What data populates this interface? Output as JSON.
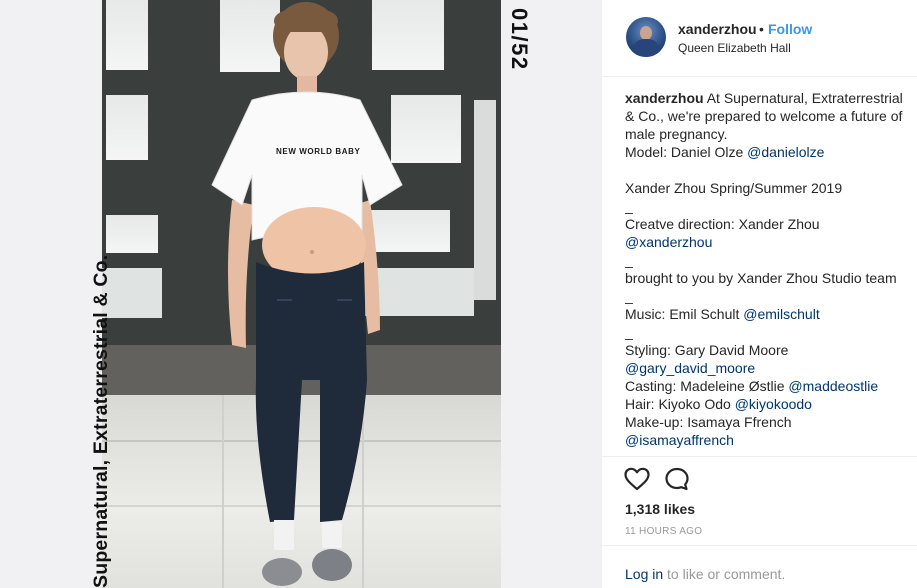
{
  "media": {
    "side_text_left": "Supernatural, Extraterrestrial & Co.",
    "side_text_right": "01/52",
    "shirt_text": "NEW WORLD BABY"
  },
  "header": {
    "username": "xanderzhou",
    "separator": "•",
    "follow_label": "Follow",
    "location": "Queen Elizabeth Hall"
  },
  "caption": {
    "username": "xanderzhou",
    "lines": [
      {
        "text": " At Supernatural, Extraterrestrial & Co., we're prepared to welcome a future of male pregnancy.",
        "mention": ""
      },
      {
        "text": "Model: Daniel Olze ",
        "mention": "@danielolze"
      },
      {
        "text": "",
        "mention": ""
      },
      {
        "text": "Xander Zhou Spring/Summer 2019",
        "mention": ""
      },
      {
        "text": "_",
        "mention": ""
      },
      {
        "text": "Creatve direction: Xander Zhou ",
        "mention": "@xanderzhou"
      },
      {
        "text": "_",
        "mention": ""
      },
      {
        "text": "brought to you by Xander Zhou Studio team",
        "mention": ""
      },
      {
        "text": "_",
        "mention": ""
      },
      {
        "text": "Music: Emil Schult ",
        "mention": "@emilschult"
      },
      {
        "text": "_",
        "mention": ""
      },
      {
        "text": "Styling: Gary David Moore ",
        "mention": "@gary_david_moore"
      },
      {
        "text": "Casting: Madeleine Østlie ",
        "mention": "@maddeostlie"
      },
      {
        "text": "Hair: Kiyoko Odo ",
        "mention": "@kiyokoodo"
      },
      {
        "text": "Make-up: Isamaya Ffrench",
        "mention": ""
      },
      {
        "text": "",
        "mention": "@isamayaffrench"
      }
    ]
  },
  "actions": {
    "like_icon": "heart-outline-icon",
    "comment_icon": "speech-bubble-icon",
    "likes": "1,318 likes",
    "time": "11 HOURS AGO",
    "login_link": "Log in",
    "login_rest": " to like or comment."
  },
  "colors": {
    "link": "#003569",
    "follow": "#3897f0",
    "muted": "#999999"
  }
}
